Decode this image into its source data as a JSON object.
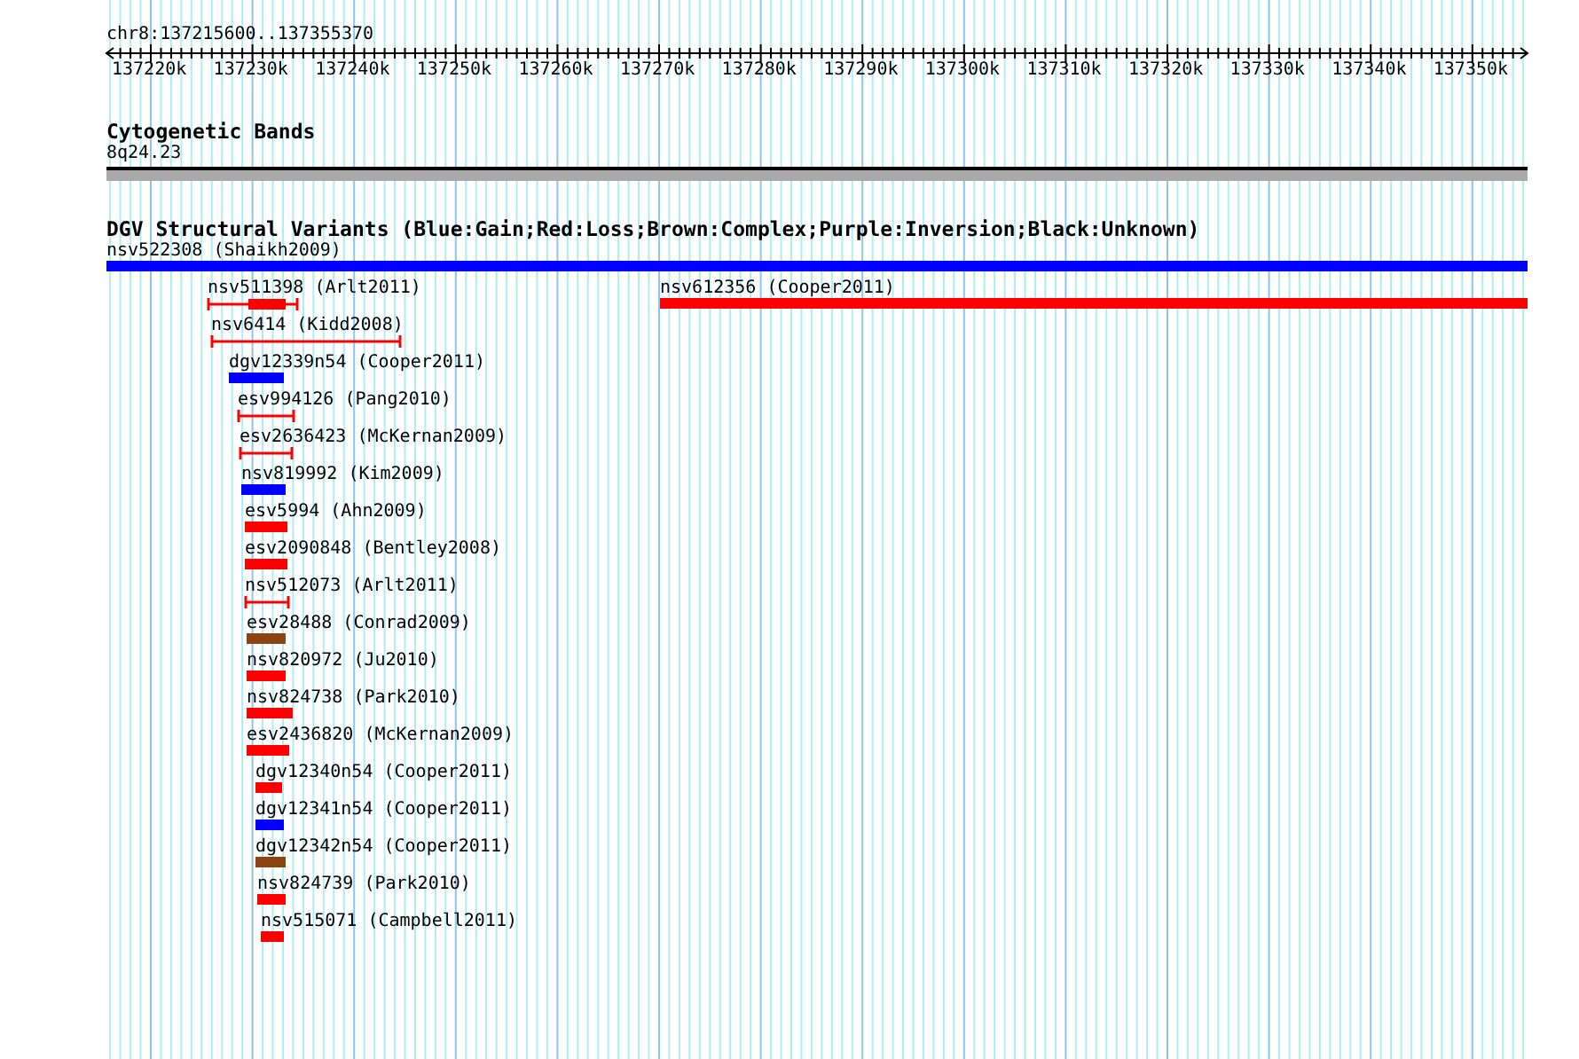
{
  "location": "chr8:137215600..137355370",
  "ruler": {
    "labels": [
      "137220k",
      "137230k",
      "137240k",
      "137250k",
      "137260k",
      "137270k",
      "137280k",
      "137290k",
      "137300k",
      "137310k",
      "137320k",
      "137330k",
      "137340k",
      "137350k"
    ]
  },
  "cytogenetic_bands": {
    "title": "Cytogenetic Bands",
    "band": "8q24.23"
  },
  "dgv_track": {
    "title": "DGV Structural Variants (Blue:Gain;Red:Loss;Brown:Complex;Purple:Inversion;Black:Unknown)",
    "features": [
      {
        "label": "nsv522308 (Shaikh2009)",
        "kind": "block",
        "color": "#0000ff"
      },
      {
        "label": "nsv511398 (Arlt2011)",
        "kind": "range_block",
        "color": "#ff0000"
      },
      {
        "label": "nsv612356 (Cooper2011)",
        "kind": "block",
        "color": "#ff0000"
      },
      {
        "label": "nsv6414 (Kidd2008)",
        "kind": "range",
        "color": "#ff0000"
      },
      {
        "label": "dgv12339n54 (Cooper2011)",
        "kind": "block",
        "color": "#0000ff"
      },
      {
        "label": "esv994126 (Pang2010)",
        "kind": "range",
        "color": "#ff0000"
      },
      {
        "label": "esv2636423 (McKernan2009)",
        "kind": "range",
        "color": "#ff0000"
      },
      {
        "label": "nsv819992 (Kim2009)",
        "kind": "block",
        "color": "#0000ff"
      },
      {
        "label": "esv5994 (Ahn2009)",
        "kind": "block",
        "color": "#ff0000"
      },
      {
        "label": "esv2090848 (Bentley2008)",
        "kind": "block",
        "color": "#ff0000"
      },
      {
        "label": "nsv512073 (Arlt2011)",
        "kind": "range",
        "color": "#ff0000"
      },
      {
        "label": "esv28488 (Conrad2009)",
        "kind": "block",
        "color": "#8b4513"
      },
      {
        "label": "nsv820972 (Ju2010)",
        "kind": "block",
        "color": "#ff0000"
      },
      {
        "label": "nsv824738 (Park2010)",
        "kind": "block",
        "color": "#ff0000"
      },
      {
        "label": "esv2436820 (McKernan2009)",
        "kind": "block",
        "color": "#ff0000"
      },
      {
        "label": "dgv12340n54 (Cooper2011)",
        "kind": "block",
        "color": "#ff0000"
      },
      {
        "label": "dgv12341n54 (Cooper2011)",
        "kind": "block",
        "color": "#0000ff"
      },
      {
        "label": "dgv12342n54 (Cooper2011)",
        "kind": "block",
        "color": "#8b4513"
      },
      {
        "label": "nsv824739 (Park2010)",
        "kind": "block",
        "color": "#ff0000"
      },
      {
        "label": "nsv515071 (Campbell2011)",
        "kind": "block",
        "color": "#ff0000"
      }
    ]
  }
}
